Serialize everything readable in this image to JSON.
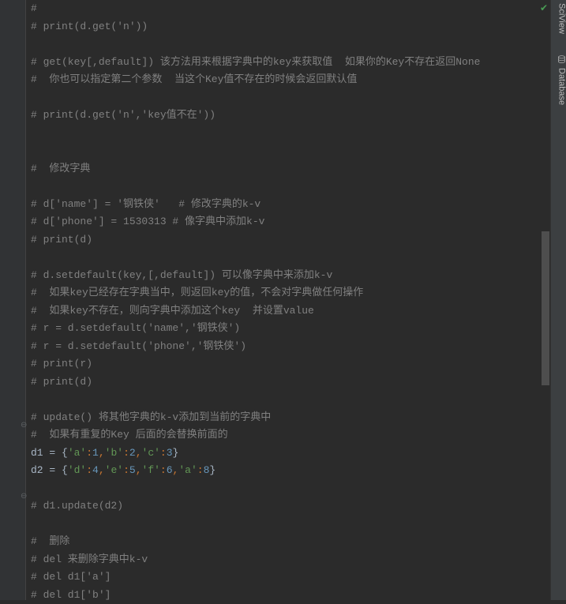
{
  "side_tabs": {
    "sciview": "SciView",
    "database": "Database"
  },
  "code_lines": [
    {
      "type": "comment",
      "content": "#"
    },
    {
      "type": "comment",
      "content": "# print(d.get('n'))"
    },
    {
      "type": "blank",
      "content": ""
    },
    {
      "type": "comment",
      "content": "# get(key[,default]) 该方法用来根据字典中的key来获取值  如果你的Key不存在返回None"
    },
    {
      "type": "comment",
      "content": "#  你也可以指定第二个参数  当这个Key值不存在的时候会返回默认值"
    },
    {
      "type": "blank",
      "content": ""
    },
    {
      "type": "comment",
      "content": "# print(d.get('n','key值不在'))"
    },
    {
      "type": "blank",
      "content": ""
    },
    {
      "type": "blank",
      "content": ""
    },
    {
      "type": "comment",
      "content": "#  修改字典"
    },
    {
      "type": "blank",
      "content": ""
    },
    {
      "type": "comment",
      "content": "# d['name'] = '钢铁侠'   # 修改字典的k-v"
    },
    {
      "type": "comment",
      "content": "# d['phone'] = 1530313 # 像字典中添加k-v"
    },
    {
      "type": "comment",
      "content": "# print(d)"
    },
    {
      "type": "blank",
      "content": ""
    },
    {
      "type": "comment",
      "content": "# d.setdefault(key,[,default]) 可以像字典中来添加k-v"
    },
    {
      "type": "comment",
      "content": "#  如果key已经存在字典当中，则返回key的值，不会对字典做任何操作"
    },
    {
      "type": "comment",
      "content": "#  如果key不存在，则向字典中添加这个key  并设置value"
    },
    {
      "type": "comment",
      "content": "# r = d.setdefault('name','钢铁侠')"
    },
    {
      "type": "comment",
      "content": "# r = d.setdefault('phone','钢铁侠')"
    },
    {
      "type": "comment",
      "content": "# print(r)"
    },
    {
      "type": "comment",
      "content": "# print(d)"
    },
    {
      "type": "blank",
      "content": ""
    },
    {
      "type": "comment",
      "content": "# update() 将其他字典的k-v添加到当前的字典中"
    },
    {
      "type": "comment",
      "content": "#  如果有重复的Key 后面的会替换前面的"
    },
    {
      "type": "dict1",
      "d1_assign": "d1 = ",
      "pairs": [
        {
          "k": "'a'",
          "v": "1"
        },
        {
          "k": "'b'",
          "v": "2"
        },
        {
          "k": "'c'",
          "v": "3"
        }
      ]
    },
    {
      "type": "dict2",
      "d2_assign": "d2 = ",
      "pairs": [
        {
          "k": "'d'",
          "v": "4"
        },
        {
          "k": "'e'",
          "v": "5"
        },
        {
          "k": "'f'",
          "v": "6"
        },
        {
          "k": "'a'",
          "v": "8"
        }
      ]
    },
    {
      "type": "blank",
      "content": ""
    },
    {
      "type": "comment",
      "content": "# d1.update(d2)"
    },
    {
      "type": "blank",
      "content": ""
    },
    {
      "type": "comment",
      "content": "#  删除"
    },
    {
      "type": "comment",
      "content": "# del 来删除字典中k-v"
    },
    {
      "type": "comment",
      "content": "# del d1['a']"
    },
    {
      "type": "comment",
      "content": "# del d1['b']"
    }
  ]
}
